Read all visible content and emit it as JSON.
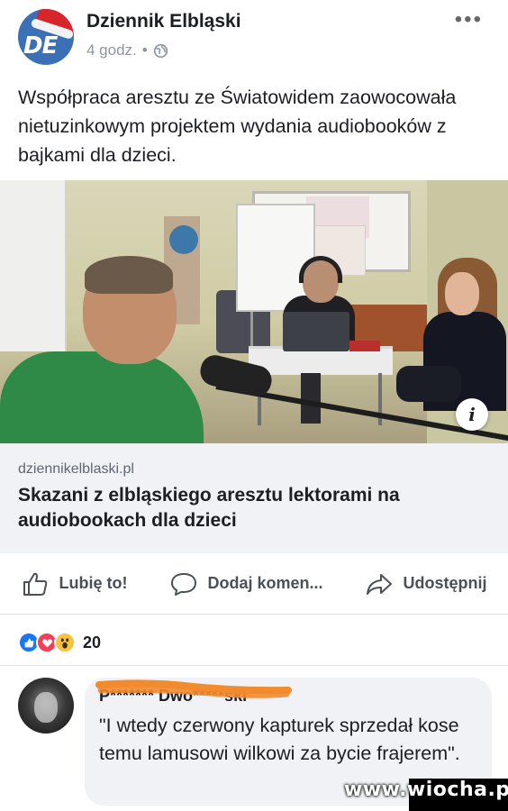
{
  "header": {
    "page_name": "Dziennik Elbląski",
    "timestamp": "4 godz.",
    "separator": "•",
    "avatar_logo_text": "DE",
    "more_label": "•••"
  },
  "post": {
    "text": "Współpraca aresztu ze Światowidem zaowocowała nietuzinkowym projektem wydania audiobooków z bajkami dla dzieci."
  },
  "link_preview": {
    "domain": "dziennikelblaski.pl",
    "title": "Skazani z elbląskiego aresztu lektorami na audiobookach dla dzieci",
    "info_label": "i"
  },
  "actions": {
    "like_label": "Lubię to!",
    "comment_label": "Dodaj komen...",
    "share_label": "Udostępnij"
  },
  "reactions": {
    "count": "20",
    "types": [
      "like",
      "love",
      "wow"
    ]
  },
  "comment": {
    "author": "P******* Dwo*****ski",
    "text": "\"I wtedy czerwony kapturek sprzedał kose temu lamusowi wilkowi za bycie frajerem\"."
  },
  "watermark": {
    "text": "www.wiocha.pl"
  },
  "colors": {
    "fb_blue": "#1877f2",
    "love_red": "#f33e58",
    "wow_yellow": "#f7c33c",
    "redaction_orange": "#f28a2e",
    "link_bg": "#f0f2f5",
    "prisoner_green": "#2e8a46"
  },
  "icons": {
    "privacy": "globe-icon",
    "more": "more-horizontal-icon",
    "like": "thumbs-up-icon",
    "comment": "comment-bubble-icon",
    "share": "share-arrow-icon",
    "info": "info-icon"
  }
}
